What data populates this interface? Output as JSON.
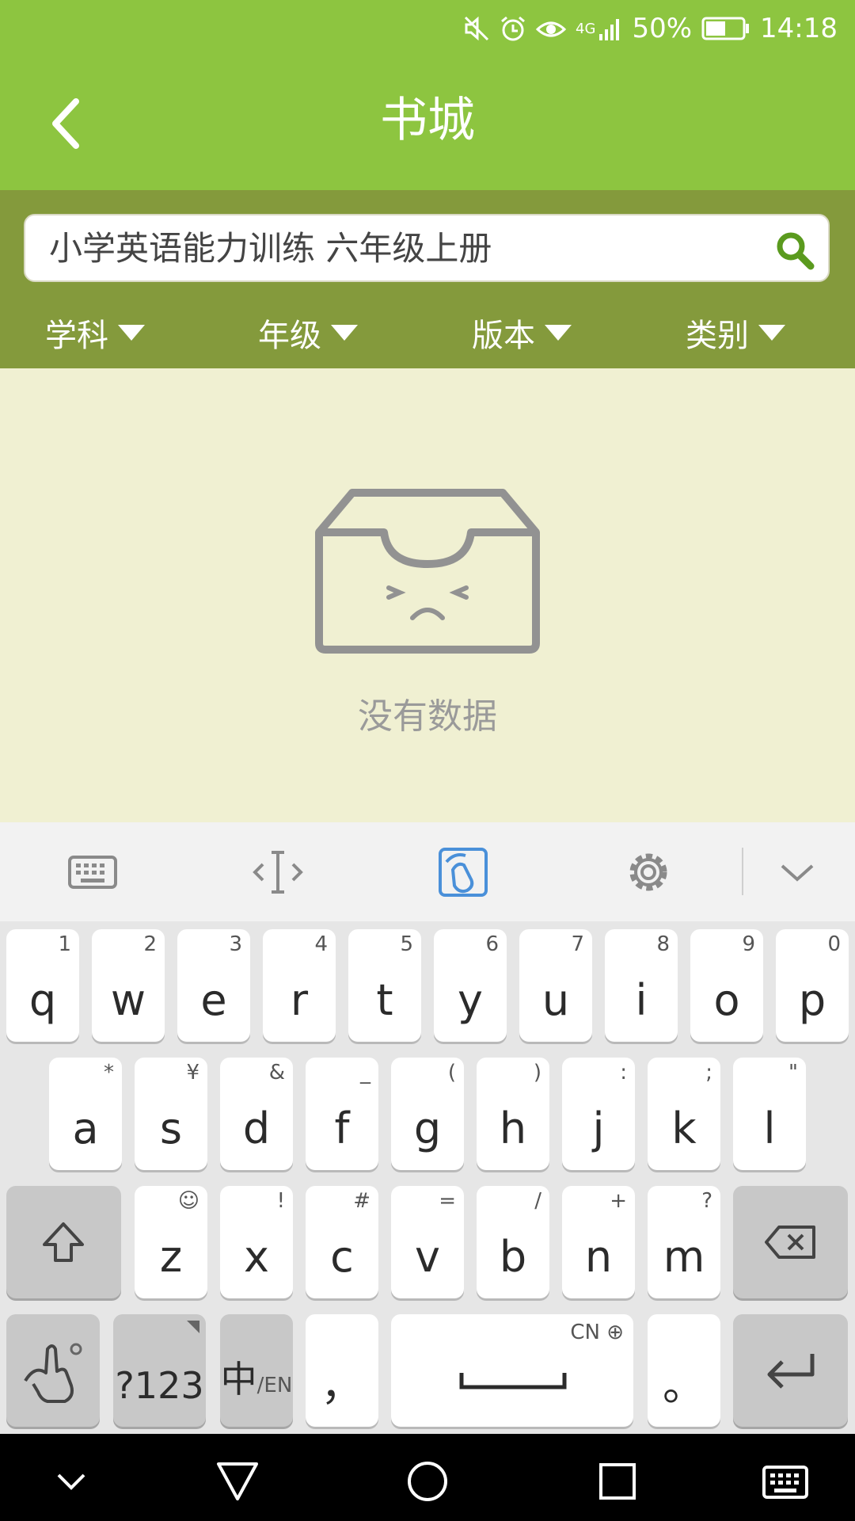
{
  "status_bar": {
    "battery": "50%",
    "time": "14:18",
    "network": "4G",
    "icons": [
      "mute-icon",
      "alarm-icon",
      "eye-icon",
      "signal-icon",
      "battery-icon"
    ]
  },
  "header": {
    "title": "书城"
  },
  "search": {
    "value": "小学英语能力训练 六年级上册"
  },
  "filters": [
    {
      "label": "学科"
    },
    {
      "label": "年级"
    },
    {
      "label": "版本"
    },
    {
      "label": "类别"
    }
  ],
  "empty_state": {
    "message": "没有数据"
  },
  "keyboard": {
    "toolbar_icons": [
      "keyboard-icon",
      "cursor-icon",
      "touch-icon",
      "settings-icon",
      "collapse-icon"
    ],
    "row1": [
      {
        "main": "q",
        "sub": "1"
      },
      {
        "main": "w",
        "sub": "2"
      },
      {
        "main": "e",
        "sub": "3"
      },
      {
        "main": "r",
        "sub": "4"
      },
      {
        "main": "t",
        "sub": "5"
      },
      {
        "main": "y",
        "sub": "6"
      },
      {
        "main": "u",
        "sub": "7"
      },
      {
        "main": "i",
        "sub": "8"
      },
      {
        "main": "o",
        "sub": "9"
      },
      {
        "main": "p",
        "sub": "0"
      }
    ],
    "row2": [
      {
        "main": "a",
        "sub": "*"
      },
      {
        "main": "s",
        "sub": "¥"
      },
      {
        "main": "d",
        "sub": "&"
      },
      {
        "main": "f",
        "sub": "_"
      },
      {
        "main": "g",
        "sub": "("
      },
      {
        "main": "h",
        "sub": ")"
      },
      {
        "main": "j",
        "sub": ":"
      },
      {
        "main": "k",
        "sub": ";"
      },
      {
        "main": "l",
        "sub": "\""
      }
    ],
    "row3": [
      {
        "main": "z",
        "sub": "☺"
      },
      {
        "main": "x",
        "sub": "!"
      },
      {
        "main": "c",
        "sub": "#"
      },
      {
        "main": "v",
        "sub": "="
      },
      {
        "main": "b",
        "sub": "/"
      },
      {
        "main": "n",
        "sub": "+"
      },
      {
        "main": "m",
        "sub": "?"
      }
    ],
    "numbers_label": "?123",
    "lang_label_zh": "中",
    "lang_label_en": "/EN",
    "comma": "，",
    "space_sub": "CN",
    "period": "。"
  },
  "nav_bar": {
    "icons": [
      "hide-icon",
      "back-icon",
      "home-icon",
      "recents-icon",
      "keyboard-switch-icon"
    ]
  },
  "colors": {
    "primary_green": "#8dc540",
    "filter_band": "#849a3c",
    "background": "#f0f0d2",
    "search_icon": "#5a9a1e",
    "active_toolbar": "#4a90d9"
  }
}
